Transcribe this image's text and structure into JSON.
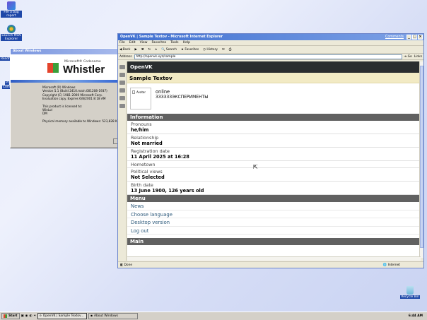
{
  "desktop": {
    "icons": [
      {
        "label": "File a bug report"
      },
      {
        "label": "Launch MSN Explorer"
      },
      {
        "label": "Recycle Bin"
      }
    ],
    "partial_labels": [
      "Readm",
      "Pr",
      "Comp"
    ]
  },
  "about": {
    "title": "About Windows",
    "brand_small": "Microsoft® Codename",
    "brand": "Whistler",
    "lines": [
      "Microsoft (R) Windows",
      "Version 5.1 (Build 2410.main.001208-1937)",
      "Copyright (C) 1981-2000 Microsoft Corp.",
      "Evaluation copy. Expires 6/8/2001 8:18 AM",
      "",
      "This product is licensed to:",
      "WinLol",
      "DM",
      "",
      "Physical memory available to Windows:   523,828 K"
    ]
  },
  "ie": {
    "title": "OpenVK | Sample Textov - Microsoft Internet Explorer",
    "comments_link": "Comments",
    "menu": [
      "File",
      "Edit",
      "View",
      "Favorites",
      "Tools",
      "Help"
    ],
    "toolbar": {
      "back": "Back",
      "search": "Search",
      "favorites": "Favorites",
      "history": "History"
    },
    "address_label": "Address",
    "address": "http://openvk.xyz/sample",
    "go": "Go",
    "links": "Links",
    "status_left": "Done",
    "status_right": "Internet"
  },
  "ovk": {
    "logo": "OpenVK",
    "page_title": "Sample Textov",
    "avatar_alt": "Avatar",
    "status": "online",
    "status_text": "ЗЗЗЗЗЗЭКСПЕРИМЕНТЫ",
    "information_header": "Information",
    "info": [
      {
        "k": "Pronouns",
        "v": "he/him"
      },
      {
        "k": "Relationship",
        "v": "Not married"
      },
      {
        "k": "Registration date",
        "v": "11 April 2025 at 16:28"
      },
      {
        "k": "Hometown",
        "v": ""
      },
      {
        "k": "Political views",
        "v": "Not Selected"
      },
      {
        "k": "Birth date",
        "v": "13 June 1900, 126 years old"
      }
    ],
    "menu_header": "Menu",
    "menu": [
      "News",
      "Choose language",
      "Desktop version",
      "Log out"
    ],
    "main_header": "Main"
  },
  "taskbar": {
    "start": "Start",
    "tasks": [
      "OpenVK | Sample Textov...",
      "About Windows"
    ],
    "clock": "6:44 AM"
  }
}
